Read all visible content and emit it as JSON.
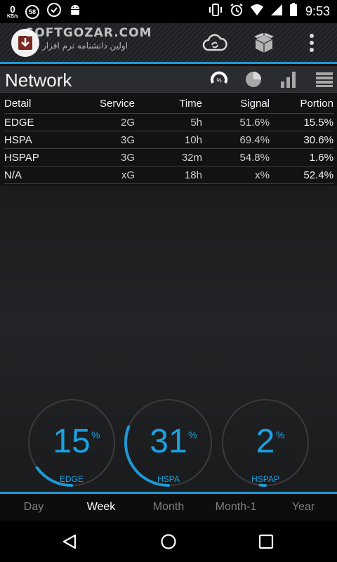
{
  "status_bar": {
    "net_speed": "0",
    "net_unit": "KB/s",
    "notif_badge": "58",
    "time": "9:53"
  },
  "app_bar": {
    "brand": "SOFTGOZAR.COM",
    "brand_sub": "اولین دانشنامه نرم افزار",
    "icons": [
      "cloud-sync-icon",
      "box-icon",
      "overflow-menu-icon"
    ]
  },
  "page": {
    "title": "Network",
    "view_icons": [
      "percent-gauge-icon",
      "pie-chart-icon",
      "signal-bars-icon",
      "list-icon"
    ]
  },
  "table": {
    "headers": [
      "Detail",
      "Service",
      "Time",
      "Signal",
      "Portion"
    ],
    "rows": [
      [
        "EDGE",
        "2G",
        "5h",
        "51.6%",
        "15.5%"
      ],
      [
        "HSPA",
        "3G",
        "10h",
        "69.4%",
        "30.6%"
      ],
      [
        "HSPAP",
        "3G",
        "32m",
        "54.8%",
        "1.6%"
      ],
      [
        "N/A",
        "xG",
        "18h",
        "x%",
        "52.4%"
      ]
    ]
  },
  "gauges": [
    {
      "value": "15",
      "unit": "%",
      "label": "EDGE",
      "fraction": 0.15
    },
    {
      "value": "31",
      "unit": "%",
      "label": "HSPA",
      "fraction": 0.31
    },
    {
      "value": "2",
      "unit": "%",
      "label": "HSPAP",
      "fraction": 0.02
    }
  ],
  "periods": {
    "items": [
      "Day",
      "Week",
      "Month",
      "Month-1",
      "Year"
    ],
    "active": "Week"
  },
  "colors": {
    "accent": "#1c9ad6",
    "gauge_track": "#3a3b3e"
  },
  "nav": [
    "back-icon",
    "home-icon",
    "recents-icon"
  ]
}
